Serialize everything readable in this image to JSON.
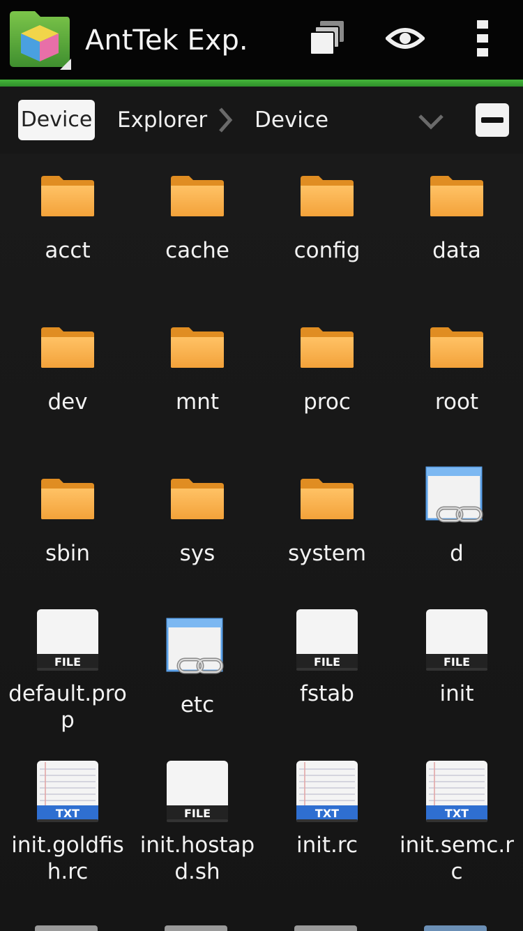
{
  "app": {
    "title": "AntTek Exp."
  },
  "actions": {
    "windows_icon": "windows-stack-icon",
    "view_icon": "eye-icon",
    "menu_icon": "overflow-menu-icon"
  },
  "path": {
    "chip_label": "Device",
    "crumb1": "Explorer",
    "crumb2": "Device"
  },
  "colors": {
    "accent": "#3aa434",
    "folder": "#f3a23a",
    "txt_badge": "#2f6fd1",
    "file_badge": "#222222"
  },
  "items": [
    {
      "name": "acct",
      "type": "folder"
    },
    {
      "name": "cache",
      "type": "folder"
    },
    {
      "name": "config",
      "type": "folder"
    },
    {
      "name": "data",
      "type": "folder"
    },
    {
      "name": "dev",
      "type": "folder"
    },
    {
      "name": "mnt",
      "type": "folder"
    },
    {
      "name": "proc",
      "type": "folder"
    },
    {
      "name": "root",
      "type": "folder"
    },
    {
      "name": "sbin",
      "type": "folder"
    },
    {
      "name": "sys",
      "type": "folder"
    },
    {
      "name": "system",
      "type": "folder"
    },
    {
      "name": "d",
      "type": "link"
    },
    {
      "name": "default.prop",
      "type": "file",
      "badge": "FILE"
    },
    {
      "name": "etc",
      "type": "link"
    },
    {
      "name": "fstab",
      "type": "file",
      "badge": "FILE"
    },
    {
      "name": "init",
      "type": "file",
      "badge": "FILE"
    },
    {
      "name": "init.goldfish.rc",
      "type": "txt",
      "badge": "TXT"
    },
    {
      "name": "init.hostapd.sh",
      "type": "file",
      "badge": "FILE"
    },
    {
      "name": "init.rc",
      "type": "txt",
      "badge": "TXT"
    },
    {
      "name": "init.semc.rc",
      "type": "txt",
      "badge": "TXT"
    }
  ]
}
